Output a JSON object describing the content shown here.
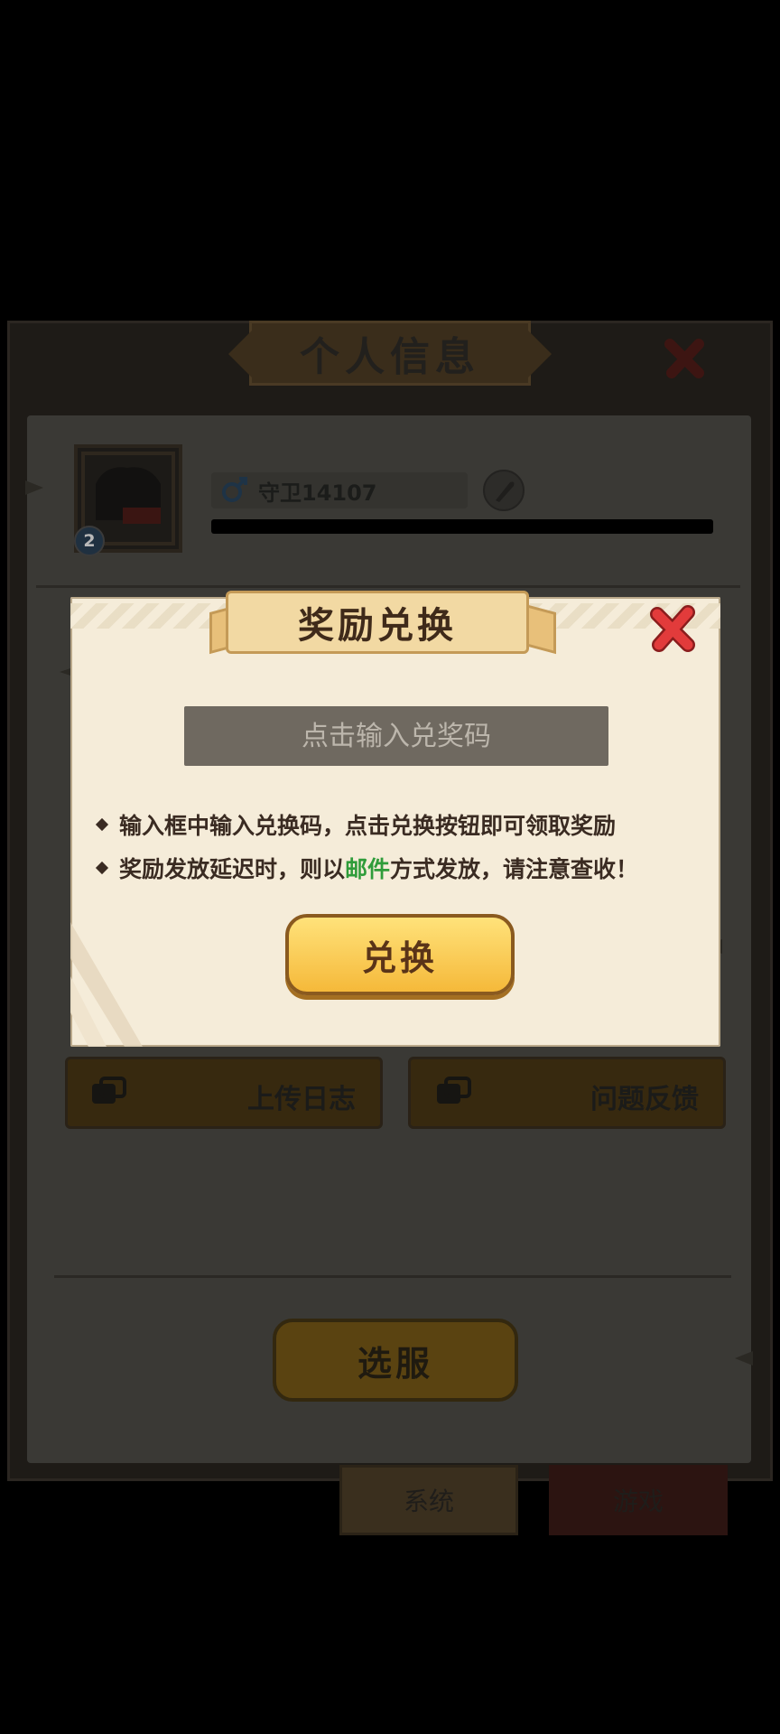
{
  "background_panel": {
    "title": "个人信息",
    "user_name": "守卫14107",
    "level_badge": "2",
    "buttons": [
      {
        "label": "上传日志",
        "icon": "chat-box-icon"
      },
      {
        "label": "问题反馈",
        "icon": "chat-box-icon"
      }
    ],
    "server_button_label": "选服",
    "tabs": [
      {
        "label": "系统",
        "active": true
      },
      {
        "label": "游戏",
        "active": false
      }
    ]
  },
  "modal": {
    "title": "奖励兑换",
    "input_placeholder": "点击输入兑奖码",
    "input_value": "",
    "tips": [
      {
        "prefix": "输入框中输入兑换码，点击兑换按钮即可领取奖励",
        "highlight": "",
        "suffix": ""
      },
      {
        "prefix": "奖励发放延迟时，则以",
        "highlight": "邮件",
        "suffix": "方式发放，请注意查收！"
      }
    ],
    "redeem_button_label": "兑换"
  },
  "colors": {
    "modal_bg": "#f5ecd9",
    "highlight_green": "#2f9c3a",
    "button_gold": "#f5b93a",
    "close_red": "#e23b3b"
  }
}
